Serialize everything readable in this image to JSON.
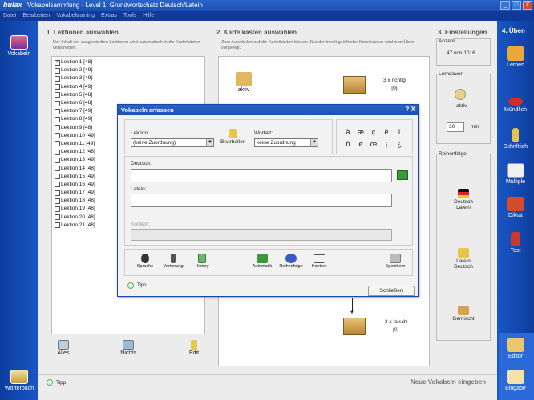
{
  "window": {
    "logo": "bulax",
    "title": "Vokabelsammlung - Level 1: Grundwortschatz Deutsch/Latein",
    "buttons": [
      "_",
      "□",
      "X"
    ]
  },
  "menu": [
    "Datei",
    "Bearbeiten",
    "Vokabeltraining",
    "Extras",
    "Tools",
    "Hilfe"
  ],
  "left_nav": {
    "top_label": "Vokabeln",
    "bottom_label": "Wörterbuch"
  },
  "right_nav": {
    "header": "4. Üben",
    "items": [
      "Lernen",
      "Mündlich",
      "Schriftlich",
      "Multiple",
      "Diktat",
      "Test"
    ],
    "bottom": [
      "Editor",
      "Eingabe"
    ]
  },
  "lessons_section": {
    "heading": "1. Lektionen auswählen",
    "description": "Der Inhalt der ausgewählten Lektionen wird automatisch in die Karteikästen verschoben.",
    "items": [
      {
        "label": "Lektion 1 [48]",
        "checked": true
      },
      {
        "label": "Lektion 2 [49]",
        "checked": false
      },
      {
        "label": "Lektion 3 [49]",
        "checked": false
      },
      {
        "label": "Lektion 4 [49]",
        "checked": false
      },
      {
        "label": "Lektion 5 [48]",
        "checked": false
      },
      {
        "label": "Lektion 6 [48]",
        "checked": false
      },
      {
        "label": "Lektion 7 [49]",
        "checked": false
      },
      {
        "label": "Lektion 8 [49]",
        "checked": false
      },
      {
        "label": "Lektion 9 [48]",
        "checked": false
      },
      {
        "label": "Lektion 10 [49]",
        "checked": false
      },
      {
        "label": "Lektion 11 [49]",
        "checked": false
      },
      {
        "label": "Lektion 12 [48]",
        "checked": false
      },
      {
        "label": "Lektion 13 [49]",
        "checked": false
      },
      {
        "label": "Lektion 14 [48]",
        "checked": false
      },
      {
        "label": "Lektion 15 [49]",
        "checked": false
      },
      {
        "label": "Lektion 16 [49]",
        "checked": false
      },
      {
        "label": "Lektion 17 [49]",
        "checked": false
      },
      {
        "label": "Lektion 18 [48]",
        "checked": false
      },
      {
        "label": "Lektion 19 [48]",
        "checked": false
      },
      {
        "label": "Lektion 20 [48]",
        "checked": false
      },
      {
        "label": "Lektion 21 [48]",
        "checked": false
      }
    ],
    "actions": [
      "Alles",
      "Nichts",
      "Edit"
    ]
  },
  "boxes_section": {
    "heading": "2. Karteikästen auswählen",
    "description": "Zum Auswählen auf die Karteikästen klicken. Nur der Inhalt geöffneter Karteikästen wird zum Üben vorgelegt.",
    "active_label": "aktiv",
    "top_box": {
      "label": "3 x richtig",
      "count": "[0]"
    },
    "bottom_box": {
      "label": "3 x falsch",
      "count": "[0]"
    }
  },
  "settings_section": {
    "heading": "3. Einstellungen",
    "count_label": "Anzahl",
    "count_value": "47 von 1016",
    "duration_label": "Lerndauer",
    "duration_active": "aktiv",
    "minutes": "30",
    "minutes_unit": "min",
    "order_label": "Reihenfolge",
    "order_options": [
      "Deutsch Latein",
      "Latein Deutsch",
      "Gemischt"
    ]
  },
  "dialog": {
    "title": "Vokabeln erfassen",
    "title_controls": "? X",
    "lektion_label": "Lektion:",
    "lektion_value": "(keine Zuordnung)",
    "bearbeiten_label": "Bearbeiten",
    "wortart_label": "Wortart:",
    "wortart_value": "keine Zuordnung",
    "special_chars": [
      "à",
      "æ",
      "ç",
      "ë",
      "ï",
      "ñ",
      "ø",
      "œ",
      "¡",
      "¿"
    ],
    "deutsch_label": "Deutsch:",
    "latein_label": "Latein:",
    "kontext_label": "Kontext:",
    "toolbar": [
      "Sprache",
      "Vertonung",
      "History",
      "Automatik",
      "Reihenfolge",
      "Kontext",
      "Speichern"
    ],
    "tipp": "Tipp",
    "close_label": "Schließen"
  },
  "bottom": {
    "tipp": "Tipp",
    "new_vocab": "Neue Vokabeln eingeben"
  }
}
